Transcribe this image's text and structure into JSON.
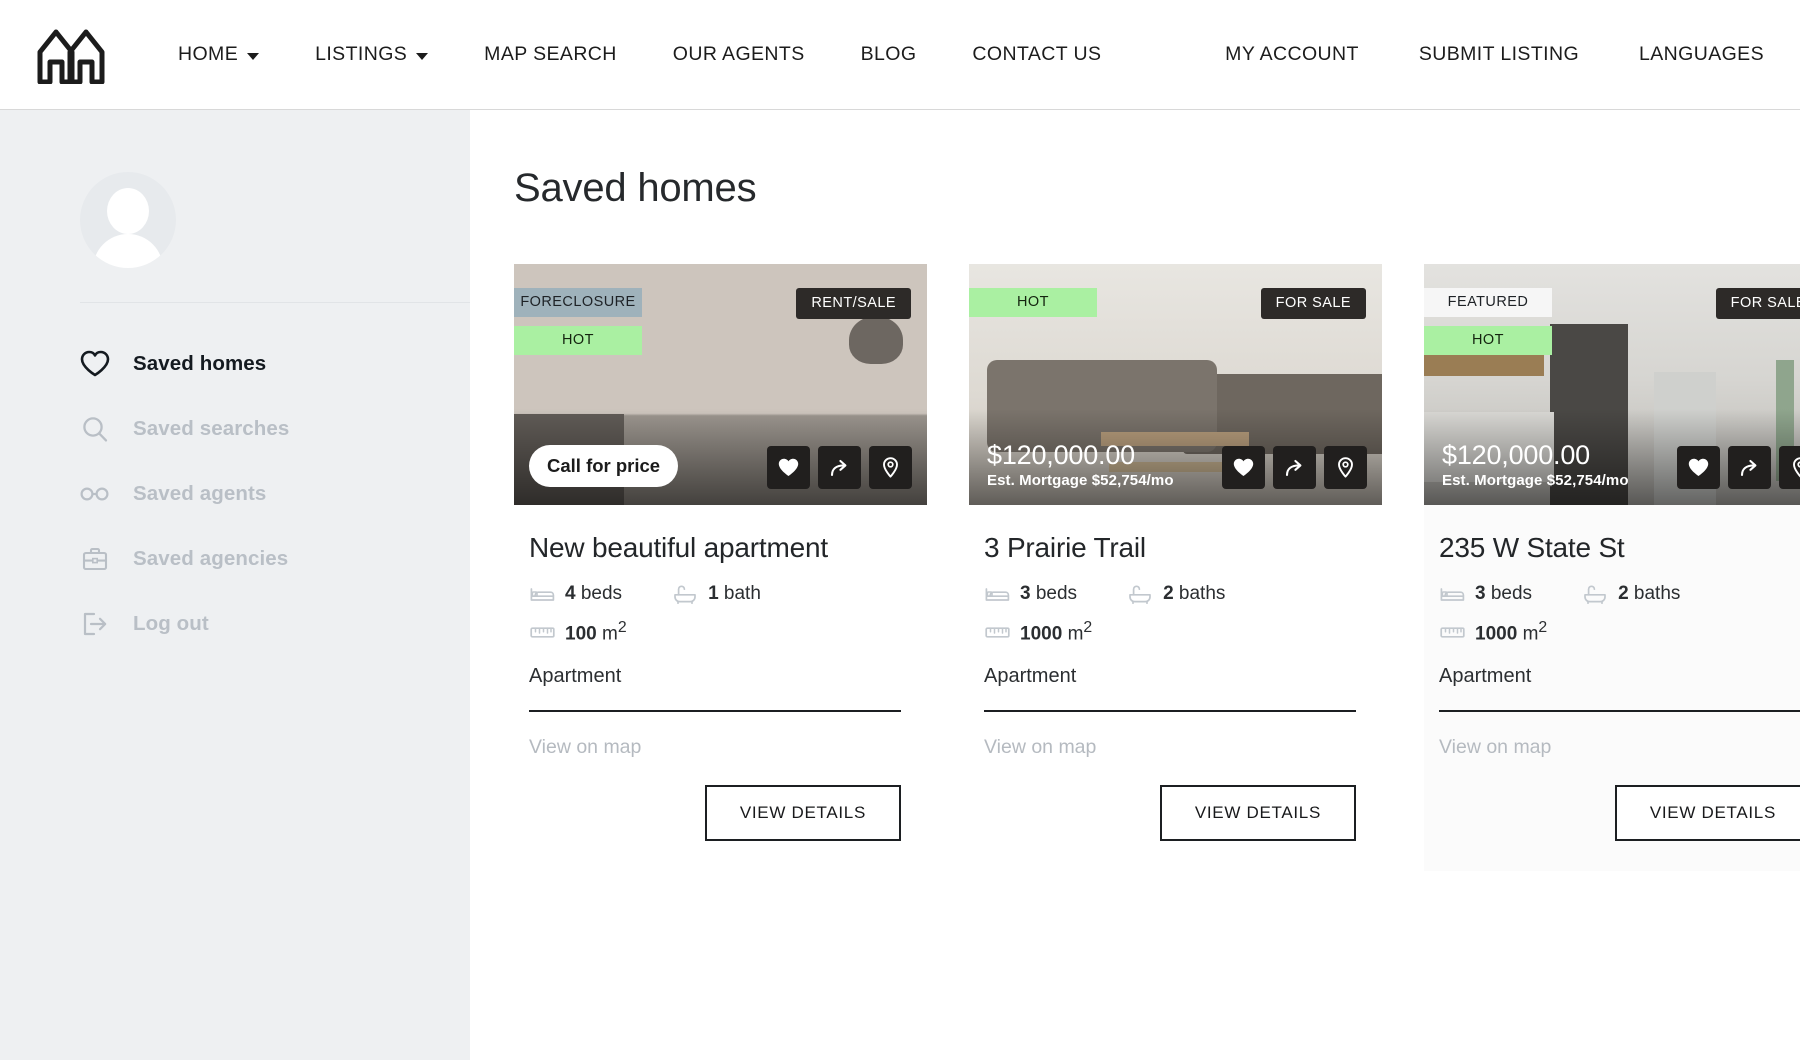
{
  "nav": {
    "logo_icon": "house-logo-icon",
    "left_items": [
      {
        "label": "HOME",
        "has_caret": true
      },
      {
        "label": "LISTINGS",
        "has_caret": true
      },
      {
        "label": "MAP SEARCH",
        "has_caret": false
      },
      {
        "label": "OUR AGENTS",
        "has_caret": false
      },
      {
        "label": "BLOG",
        "has_caret": false
      },
      {
        "label": "CONTACT US",
        "has_caret": false
      }
    ],
    "right_items": [
      {
        "label": "MY ACCOUNT"
      },
      {
        "label": "SUBMIT LISTING"
      },
      {
        "label": "LANGUAGES"
      }
    ]
  },
  "sidebar": {
    "avatar_alt": "user-avatar",
    "items": [
      {
        "label": "Saved homes",
        "icon": "heart-icon",
        "active": true
      },
      {
        "label": "Saved searches",
        "icon": "search-icon",
        "active": false
      },
      {
        "label": "Saved agents",
        "icon": "glasses-icon",
        "active": false
      },
      {
        "label": "Saved agencies",
        "icon": "briefcase-icon",
        "active": false
      },
      {
        "label": "Log out",
        "icon": "logout-icon",
        "active": false
      }
    ]
  },
  "main": {
    "title": "Saved homes",
    "view_map_label": "View on map",
    "details_label": "VIEW DETAILS",
    "cards": [
      {
        "title": "New beautiful apartment",
        "price": "Call for price",
        "price_type": "call",
        "est_mortgage": "",
        "badges": [
          {
            "text": "FORECLOSURE",
            "style": "foreclosure"
          },
          {
            "text": "HOT",
            "style": "hot"
          }
        ],
        "status_badge": "RENT/SALE",
        "beds_value": "4",
        "beds_label": "beds",
        "baths_value": "1",
        "baths_label": "bath",
        "area_value": "100",
        "area_label": "m",
        "area_exp": "2",
        "type": "Apartment",
        "shaded": false
      },
      {
        "title": "3 Prairie Trail",
        "price": "$120,000.00",
        "price_type": "amount",
        "est_mortgage": "Est. Mortgage $52,754/mo",
        "badges": [
          {
            "text": "HOT",
            "style": "hot"
          }
        ],
        "status_badge": "FOR SALE",
        "beds_value": "3",
        "beds_label": "beds",
        "baths_value": "2",
        "baths_label": "baths",
        "area_value": "1000",
        "area_label": "m",
        "area_exp": "2",
        "type": "Apartment",
        "shaded": false
      },
      {
        "title": "235 W State St",
        "price": "$120,000.00",
        "price_type": "amount",
        "est_mortgage": "Est. Mortgage $52,754/mo",
        "badges": [
          {
            "text": "FEATURED",
            "style": "featured"
          },
          {
            "text": "HOT",
            "style": "hot"
          }
        ],
        "status_badge": "FOR SALE",
        "beds_value": "3",
        "beds_label": "beds",
        "baths_value": "2",
        "baths_label": "baths",
        "area_value": "1000",
        "area_label": "m",
        "area_exp": "2",
        "type": "Apartment",
        "shaded": true
      }
    ],
    "action_icons": [
      "heart-icon",
      "share-icon",
      "map-pin-icon"
    ]
  },
  "colors": {
    "sidebar_bg": "#eef0f2",
    "hot_badge": "#aaf0a2",
    "foreclosure_badge": "#9fb2bb",
    "status_badge": "#2d2a28",
    "text_dark": "#1c1f22",
    "text_muted": "#b5bac0"
  }
}
